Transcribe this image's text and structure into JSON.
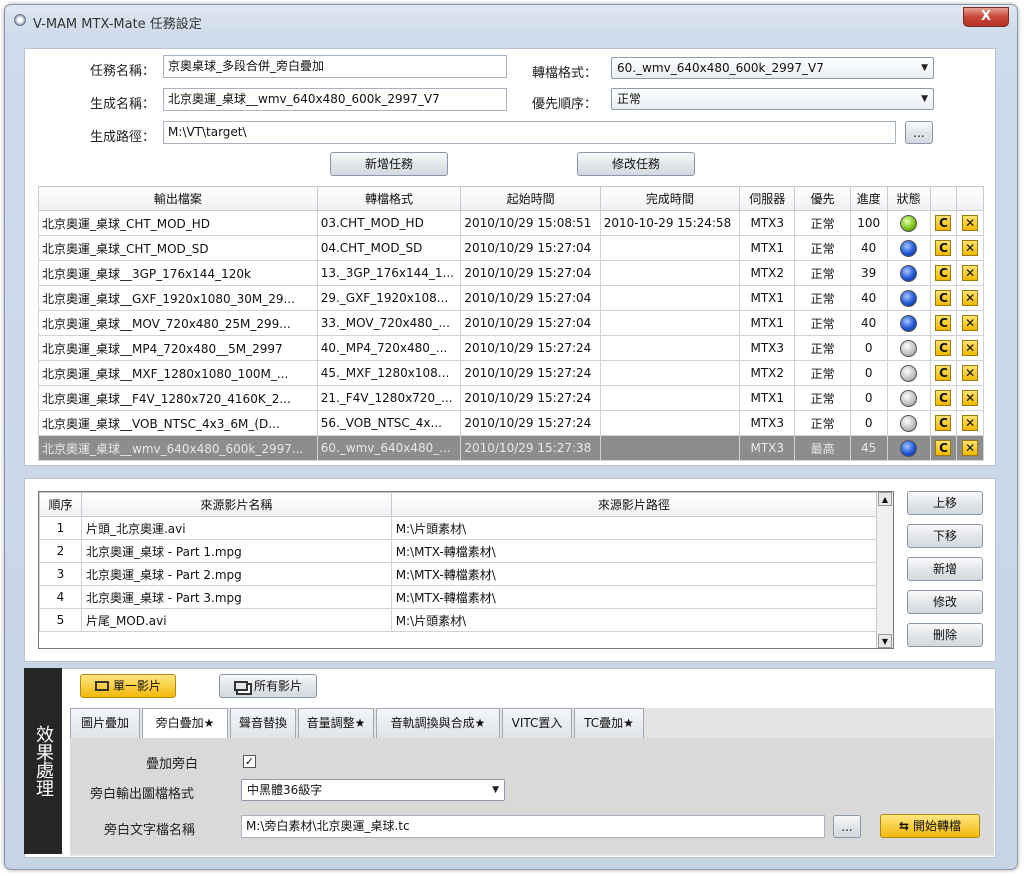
{
  "window": {
    "title": "V-MAM MTX-Mate 任務設定",
    "close_label": "X"
  },
  "form": {
    "task_name_label": "任務名稱：",
    "task_name_value": "京奧桌球_多段合併_旁白疊加",
    "output_name_label": "生成名稱：",
    "output_name_value": "北京奧運_桌球__wmv_640x480_600k_2997_V7",
    "output_path_label": "生成路徑：",
    "output_path_value": "M:\\VT\\target\\",
    "browse_label": "...",
    "format_label": "轉檔格式：",
    "format_value": "60._wmv_640x480_600k_2997_V7",
    "priority_label": "優先順序：",
    "priority_value": "正常",
    "add_task_label": "新增任務",
    "modify_task_label": "修改任務"
  },
  "jobs": {
    "headers": [
      "輸出檔案",
      "轉檔格式",
      "起始時間",
      "完成時間",
      "伺服器",
      "優先",
      "進度",
      "狀態"
    ],
    "rows": [
      {
        "file": "北京奧運_桌球_CHT_MOD_HD",
        "format": "03.CHT_MOD_HD",
        "start": "2010/10/29 15:08:51",
        "end": "2010-10-29 15:24:58",
        "server": "MTX3",
        "priority": "正常",
        "progress": "100",
        "status": "green"
      },
      {
        "file": "北京奧運_桌球_CHT_MOD_SD",
        "format": "04.CHT_MOD_SD",
        "start": "2010/10/29 15:27:04",
        "end": "",
        "server": "MTX1",
        "priority": "正常",
        "progress": "40",
        "status": "blue"
      },
      {
        "file": "北京奧運_桌球__3GP_176x144_120k",
        "format": "13._3GP_176x144_1...",
        "start": "2010/10/29 15:27:04",
        "end": "",
        "server": "MTX2",
        "priority": "正常",
        "progress": "39",
        "status": "blue"
      },
      {
        "file": "北京奧運_桌球__GXF_1920x1080_30M_29...",
        "format": "29._GXF_1920x108...",
        "start": "2010/10/29 15:27:04",
        "end": "",
        "server": "MTX1",
        "priority": "正常",
        "progress": "40",
        "status": "blue"
      },
      {
        "file": "北京奧運_桌球__MOV_720x480_25M_299...",
        "format": "33._MOV_720x480_...",
        "start": "2010/10/29 15:27:04",
        "end": "",
        "server": "MTX1",
        "priority": "正常",
        "progress": "40",
        "status": "blue"
      },
      {
        "file": "北京奧運_桌球__MP4_720x480__5M_2997",
        "format": "40._MP4_720x480_...",
        "start": "2010/10/29 15:27:24",
        "end": "",
        "server": "MTX3",
        "priority": "正常",
        "progress": "0",
        "status": "gray"
      },
      {
        "file": "北京奧運_桌球__MXF_1280x1080_100M_...",
        "format": "45._MXF_1280x108...",
        "start": "2010/10/29 15:27:24",
        "end": "",
        "server": "MTX2",
        "priority": "正常",
        "progress": "0",
        "status": "gray"
      },
      {
        "file": "北京奧運_桌球__F4V_1280x720_4160K_2...",
        "format": "21._F4V_1280x720_...",
        "start": "2010/10/29 15:27:24",
        "end": "",
        "server": "MTX1",
        "priority": "正常",
        "progress": "0",
        "status": "gray"
      },
      {
        "file": "北京奧運_桌球__VOB_NTSC_4x3_6M_(D...",
        "format": "56._VOB_NTSC_4x...",
        "start": "2010/10/29 15:27:24",
        "end": "",
        "server": "MTX3",
        "priority": "正常",
        "progress": "0",
        "status": "gray"
      },
      {
        "file": "北京奧運_桌球__wmv_640x480_600k_2997...",
        "format": "60._wmv_640x480_...",
        "start": "2010/10/29 15:27:38",
        "end": "",
        "server": "MTX3",
        "priority": "最高",
        "progress": "45",
        "status": "blue",
        "selected": true
      }
    ],
    "retry_icon": "C",
    "delete_icon": "✕"
  },
  "sources": {
    "headers": [
      "順序",
      "來源影片名稱",
      "來源影片路徑"
    ],
    "rows": [
      {
        "order": "1",
        "name": "片頭_北京奧運.avi",
        "path": "M:\\片頭素材\\"
      },
      {
        "order": "2",
        "name": "北京奧運_桌球 - Part 1.mpg",
        "path": "M:\\MTX-轉檔素材\\"
      },
      {
        "order": "3",
        "name": "北京奧運_桌球 - Part 2.mpg",
        "path": "M:\\MTX-轉檔素材\\"
      },
      {
        "order": "4",
        "name": "北京奧運_桌球 - Part 3.mpg",
        "path": "M:\\MTX-轉檔素材\\"
      },
      {
        "order": "5",
        "name": "片尾_MOD.avi",
        "path": "M:\\片頭素材\\"
      }
    ],
    "buttons": {
      "up": "上移",
      "down": "下移",
      "add": "新增",
      "modify": "修改",
      "delete": "刪除"
    }
  },
  "effects": {
    "side_label": "效果處理",
    "single_video": "單一影片",
    "all_videos": "所有影片",
    "tabs": [
      "圖片疊加",
      "旁白疊加★",
      "聲音替換",
      "音量調整★",
      "音軌調換與合成★",
      "VITC置入",
      "TC疊加★"
    ],
    "active_tab": 1,
    "overlay_label": "疊加旁白",
    "overlay_checked": "✓",
    "output_format_label": "旁白輸出圖檔格式",
    "output_format_value": "中黑體36級字",
    "text_file_label": "旁白文字檔名稱",
    "text_file_value": "M:\\旁白素材\\北京奧運_桌球.tc",
    "browse_label": "...",
    "start_label": "開始轉檔"
  }
}
